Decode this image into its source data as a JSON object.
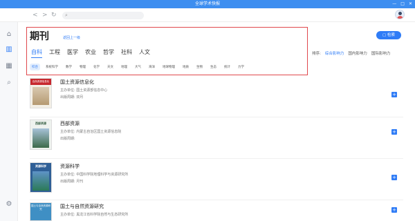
{
  "window": {
    "title": "全球学术快报",
    "controls": [
      "—",
      "□",
      "✕"
    ]
  },
  "toolbar": {
    "back_icon": "<",
    "forward_icon": ">",
    "refresh_icon": "↻",
    "search_placeholder": ""
  },
  "sidebar": {
    "items": [
      {
        "icon": "home-icon",
        "glyph": "⌂"
      },
      {
        "icon": "journal-icon",
        "glyph": "▥"
      },
      {
        "icon": "library-icon",
        "glyph": "▦"
      },
      {
        "icon": "search-icon",
        "glyph": "⌕"
      },
      {
        "icon": "settings-icon",
        "glyph": "⚙"
      }
    ]
  },
  "header": {
    "title": "期刊",
    "back_link": "返回上一级"
  },
  "categories": [
    "自科",
    "工程",
    "医学",
    "农业",
    "哲学",
    "社科",
    "人文"
  ],
  "subcategories": [
    "综合",
    "系统科学",
    "数学",
    "物理",
    "化学",
    "天文",
    "地理",
    "大气",
    "海洋",
    "地球物理",
    "地质",
    "生物",
    "生态",
    "统计",
    "力学"
  ],
  "search_button": "检索",
  "sort": {
    "label": "排序:",
    "options": [
      "综合影响力",
      "国内影响力",
      "国际影响力"
    ]
  },
  "journals": [
    {
      "title": "国土资源信息化",
      "sponsor_label": "主办单位:",
      "sponsor": "国土资源部信息中心",
      "cycle_label": "出版周期:",
      "cycle": "双月",
      "cover_text": "自然资源信息化",
      "cover_color": "#c7282e"
    },
    {
      "title": "西部资源",
      "sponsor_label": "主办单位:",
      "sponsor": "内蒙古自治区国土资源信息院",
      "cycle_label": "出版周期:",
      "cycle": "",
      "cover_text": "西部资源",
      "cover_color": "#2f5a3d"
    },
    {
      "title": "资源科学",
      "sponsor_label": "主办单位:",
      "sponsor": "中国科学院地理科学与资源研究所",
      "cycle_label": "出版周期:",
      "cycle": "月刊",
      "cover_text": "资源科学",
      "cover_color": "#3a6fb0"
    },
    {
      "title": "国土与自然资源研究",
      "sponsor_label": "主办单位:",
      "sponsor": "黑龙江省科学院自然与生态研究所",
      "cycle_label": "",
      "cycle": "",
      "cover_text": "国土与自然资源研究",
      "cover_color": "#3f8fc4"
    }
  ],
  "add_glyph": "+",
  "colors": {
    "accent": "#2f7cf6",
    "titlebar": "#3d8ef0",
    "highlight_border": "#e0474c"
  }
}
